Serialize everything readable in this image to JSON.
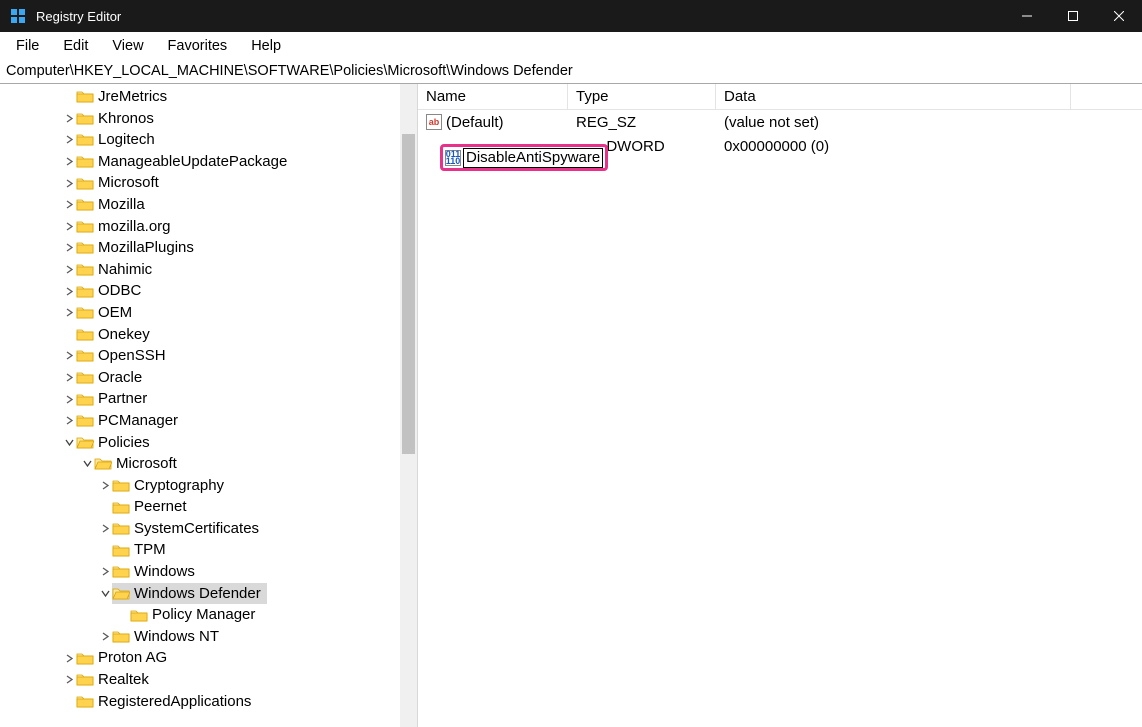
{
  "window": {
    "title": "Registry Editor"
  },
  "menu": {
    "file": "File",
    "edit": "Edit",
    "view": "View",
    "favorites": "Favorites",
    "help": "Help"
  },
  "address": "Computer\\HKEY_LOCAL_MACHINE\\SOFTWARE\\Policies\\Microsoft\\Windows Defender",
  "columns": {
    "name": "Name",
    "type": "Type",
    "data": "Data"
  },
  "values": [
    {
      "icon": "sz",
      "name": "(Default)",
      "type": "REG_SZ",
      "data": "(value not set)"
    },
    {
      "icon": "dw",
      "name": "DisableAntiSpyware",
      "type": "REG_DWORD",
      "data": "0x00000000 (0)",
      "editing": true
    }
  ],
  "rename_value": "DisableAntiSpyware",
  "row1_type_suffix": "_DWORD",
  "tree": [
    {
      "d": 3,
      "exp": "",
      "open": false,
      "label": "JreMetrics"
    },
    {
      "d": 3,
      "exp": ">",
      "open": false,
      "label": "Khronos"
    },
    {
      "d": 3,
      "exp": ">",
      "open": false,
      "label": "Logitech"
    },
    {
      "d": 3,
      "exp": ">",
      "open": false,
      "label": "ManageableUpdatePackage"
    },
    {
      "d": 3,
      "exp": ">",
      "open": false,
      "label": "Microsoft"
    },
    {
      "d": 3,
      "exp": ">",
      "open": false,
      "label": "Mozilla"
    },
    {
      "d": 3,
      "exp": ">",
      "open": false,
      "label": "mozilla.org"
    },
    {
      "d": 3,
      "exp": ">",
      "open": false,
      "label": "MozillaPlugins"
    },
    {
      "d": 3,
      "exp": ">",
      "open": false,
      "label": "Nahimic"
    },
    {
      "d": 3,
      "exp": ">",
      "open": false,
      "label": "ODBC"
    },
    {
      "d": 3,
      "exp": ">",
      "open": false,
      "label": "OEM"
    },
    {
      "d": 3,
      "exp": "",
      "open": false,
      "label": "Onekey"
    },
    {
      "d": 3,
      "exp": ">",
      "open": false,
      "label": "OpenSSH"
    },
    {
      "d": 3,
      "exp": ">",
      "open": false,
      "label": "Oracle"
    },
    {
      "d": 3,
      "exp": ">",
      "open": false,
      "label": "Partner"
    },
    {
      "d": 3,
      "exp": ">",
      "open": false,
      "label": "PCManager"
    },
    {
      "d": 3,
      "exp": "v",
      "open": true,
      "label": "Policies"
    },
    {
      "d": 4,
      "exp": "v",
      "open": true,
      "label": "Microsoft"
    },
    {
      "d": 5,
      "exp": ">",
      "open": false,
      "label": "Cryptography"
    },
    {
      "d": 5,
      "exp": "",
      "open": false,
      "label": "Peernet"
    },
    {
      "d": 5,
      "exp": ">",
      "open": false,
      "label": "SystemCertificates"
    },
    {
      "d": 5,
      "exp": "",
      "open": false,
      "label": "TPM"
    },
    {
      "d": 5,
      "exp": ">",
      "open": false,
      "label": "Windows"
    },
    {
      "d": 5,
      "exp": "v",
      "open": true,
      "label": "Windows Defender",
      "selected": true
    },
    {
      "d": 6,
      "exp": "",
      "open": false,
      "label": "Policy Manager"
    },
    {
      "d": 5,
      "exp": ">",
      "open": false,
      "label": "Windows NT"
    },
    {
      "d": 3,
      "exp": ">",
      "open": false,
      "label": "Proton AG"
    },
    {
      "d": 3,
      "exp": ">",
      "open": false,
      "label": "Realtek"
    },
    {
      "d": 3,
      "exp": "",
      "open": false,
      "label": "RegisteredApplications"
    }
  ]
}
